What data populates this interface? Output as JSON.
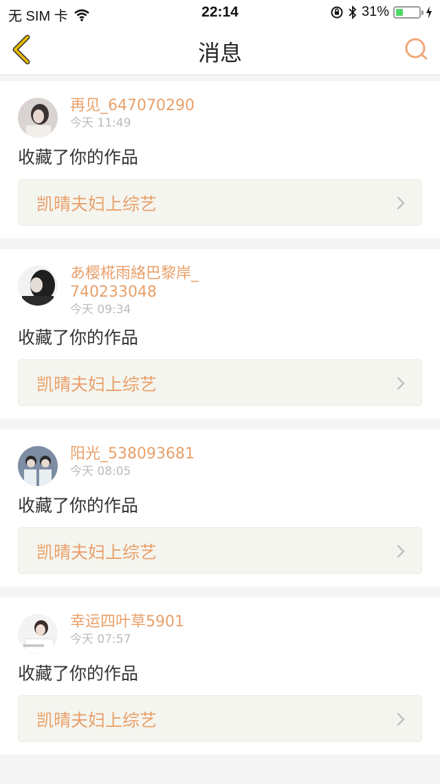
{
  "status_bar": {
    "carrier": "无 SIM 卡",
    "time": "22:14",
    "battery_percent": "31%",
    "battery_level": 0.31,
    "icons": [
      "wifi-icon",
      "orientation-lock-icon",
      "bluetooth-icon",
      "battery-icon",
      "charging-icon"
    ]
  },
  "nav": {
    "title": "消息",
    "back_icon": "chevron-left-icon",
    "search_icon": "search-icon"
  },
  "colors": {
    "accent": "#e8a06a",
    "back_arrow": "#e8b800",
    "background": "#f4f4f4",
    "card": "#ffffff",
    "work_box": "#f5f5ef"
  },
  "messages": [
    {
      "username": "再见_647070290",
      "time": "今天 11:49",
      "action": "收藏了你的作品",
      "work_title": "凯晴夫妇上综艺"
    },
    {
      "username": "あ樱椛雨絡巴黎岸_740233048",
      "time": "今天 09:34",
      "action": "收藏了你的作品",
      "work_title": "凯晴夫妇上综艺"
    },
    {
      "username": "阳光_538093681",
      "time": "今天 08:05",
      "action": "收藏了你的作品",
      "work_title": "凯晴夫妇上综艺"
    },
    {
      "username": "幸运四叶草5901",
      "time": "今天 07:57",
      "action": "收藏了你的作品",
      "work_title": "凯晴夫妇上综艺"
    }
  ]
}
